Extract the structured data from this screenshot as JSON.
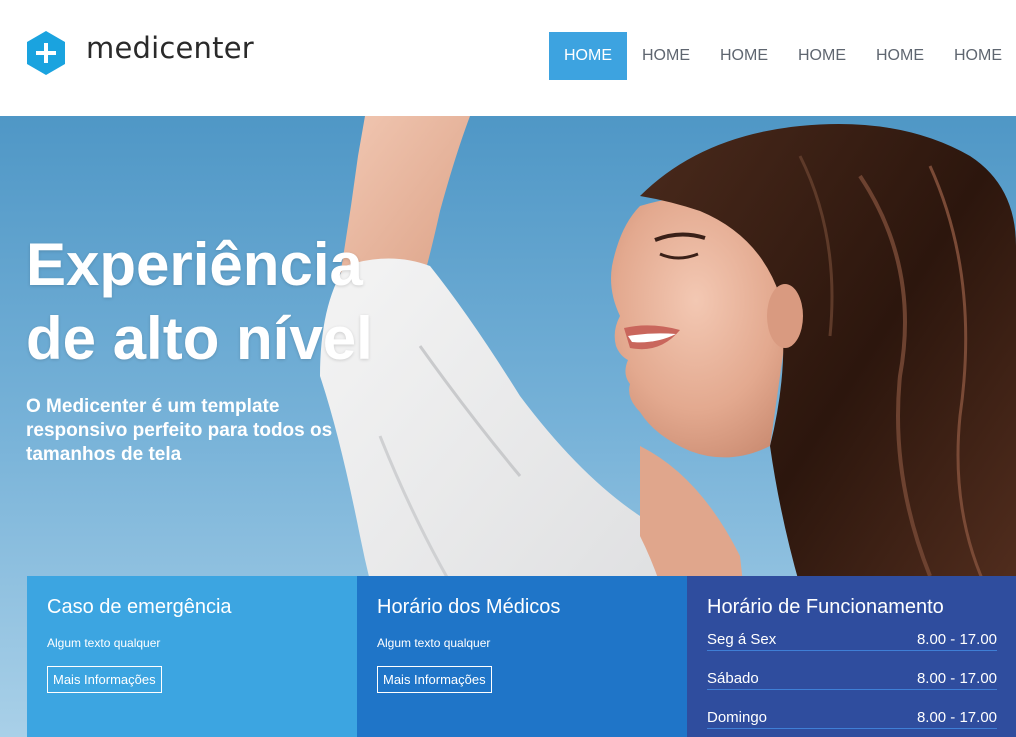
{
  "brand": {
    "name": "medicenter",
    "accent": "#3da3e0"
  },
  "nav": {
    "items": [
      {
        "label": "HOME",
        "active": true
      },
      {
        "label": "HOME",
        "active": false
      },
      {
        "label": "HOME",
        "active": false
      },
      {
        "label": "HOME",
        "active": false
      },
      {
        "label": "HOME",
        "active": false
      },
      {
        "label": "HOME",
        "active": false
      }
    ]
  },
  "hero": {
    "title_line1": "Experiência",
    "title_line2": "de alto nível",
    "subtitle": "O Medicenter é um template responsivo perfeito para todos os tamanhos de tela"
  },
  "boxes": {
    "emergency": {
      "title": "Caso de emergência",
      "text": "Algum texto qualquer",
      "button": "Mais Informações",
      "color": "#3ca5e1"
    },
    "doctors": {
      "title": "Horário dos Médicos",
      "text": "Algum texto qualquer",
      "button": "Mais Informações",
      "color": "#1f75c8"
    },
    "hours": {
      "title": "Horário de Funcionamento",
      "color": "#2f4d9e",
      "rows": [
        {
          "day": "Seg á Sex",
          "time": "8.00 - 17.00"
        },
        {
          "day": "Sábado",
          "time": "8.00 - 17.00"
        },
        {
          "day": "Domingo",
          "time": "8.00 - 17.00"
        }
      ]
    }
  }
}
